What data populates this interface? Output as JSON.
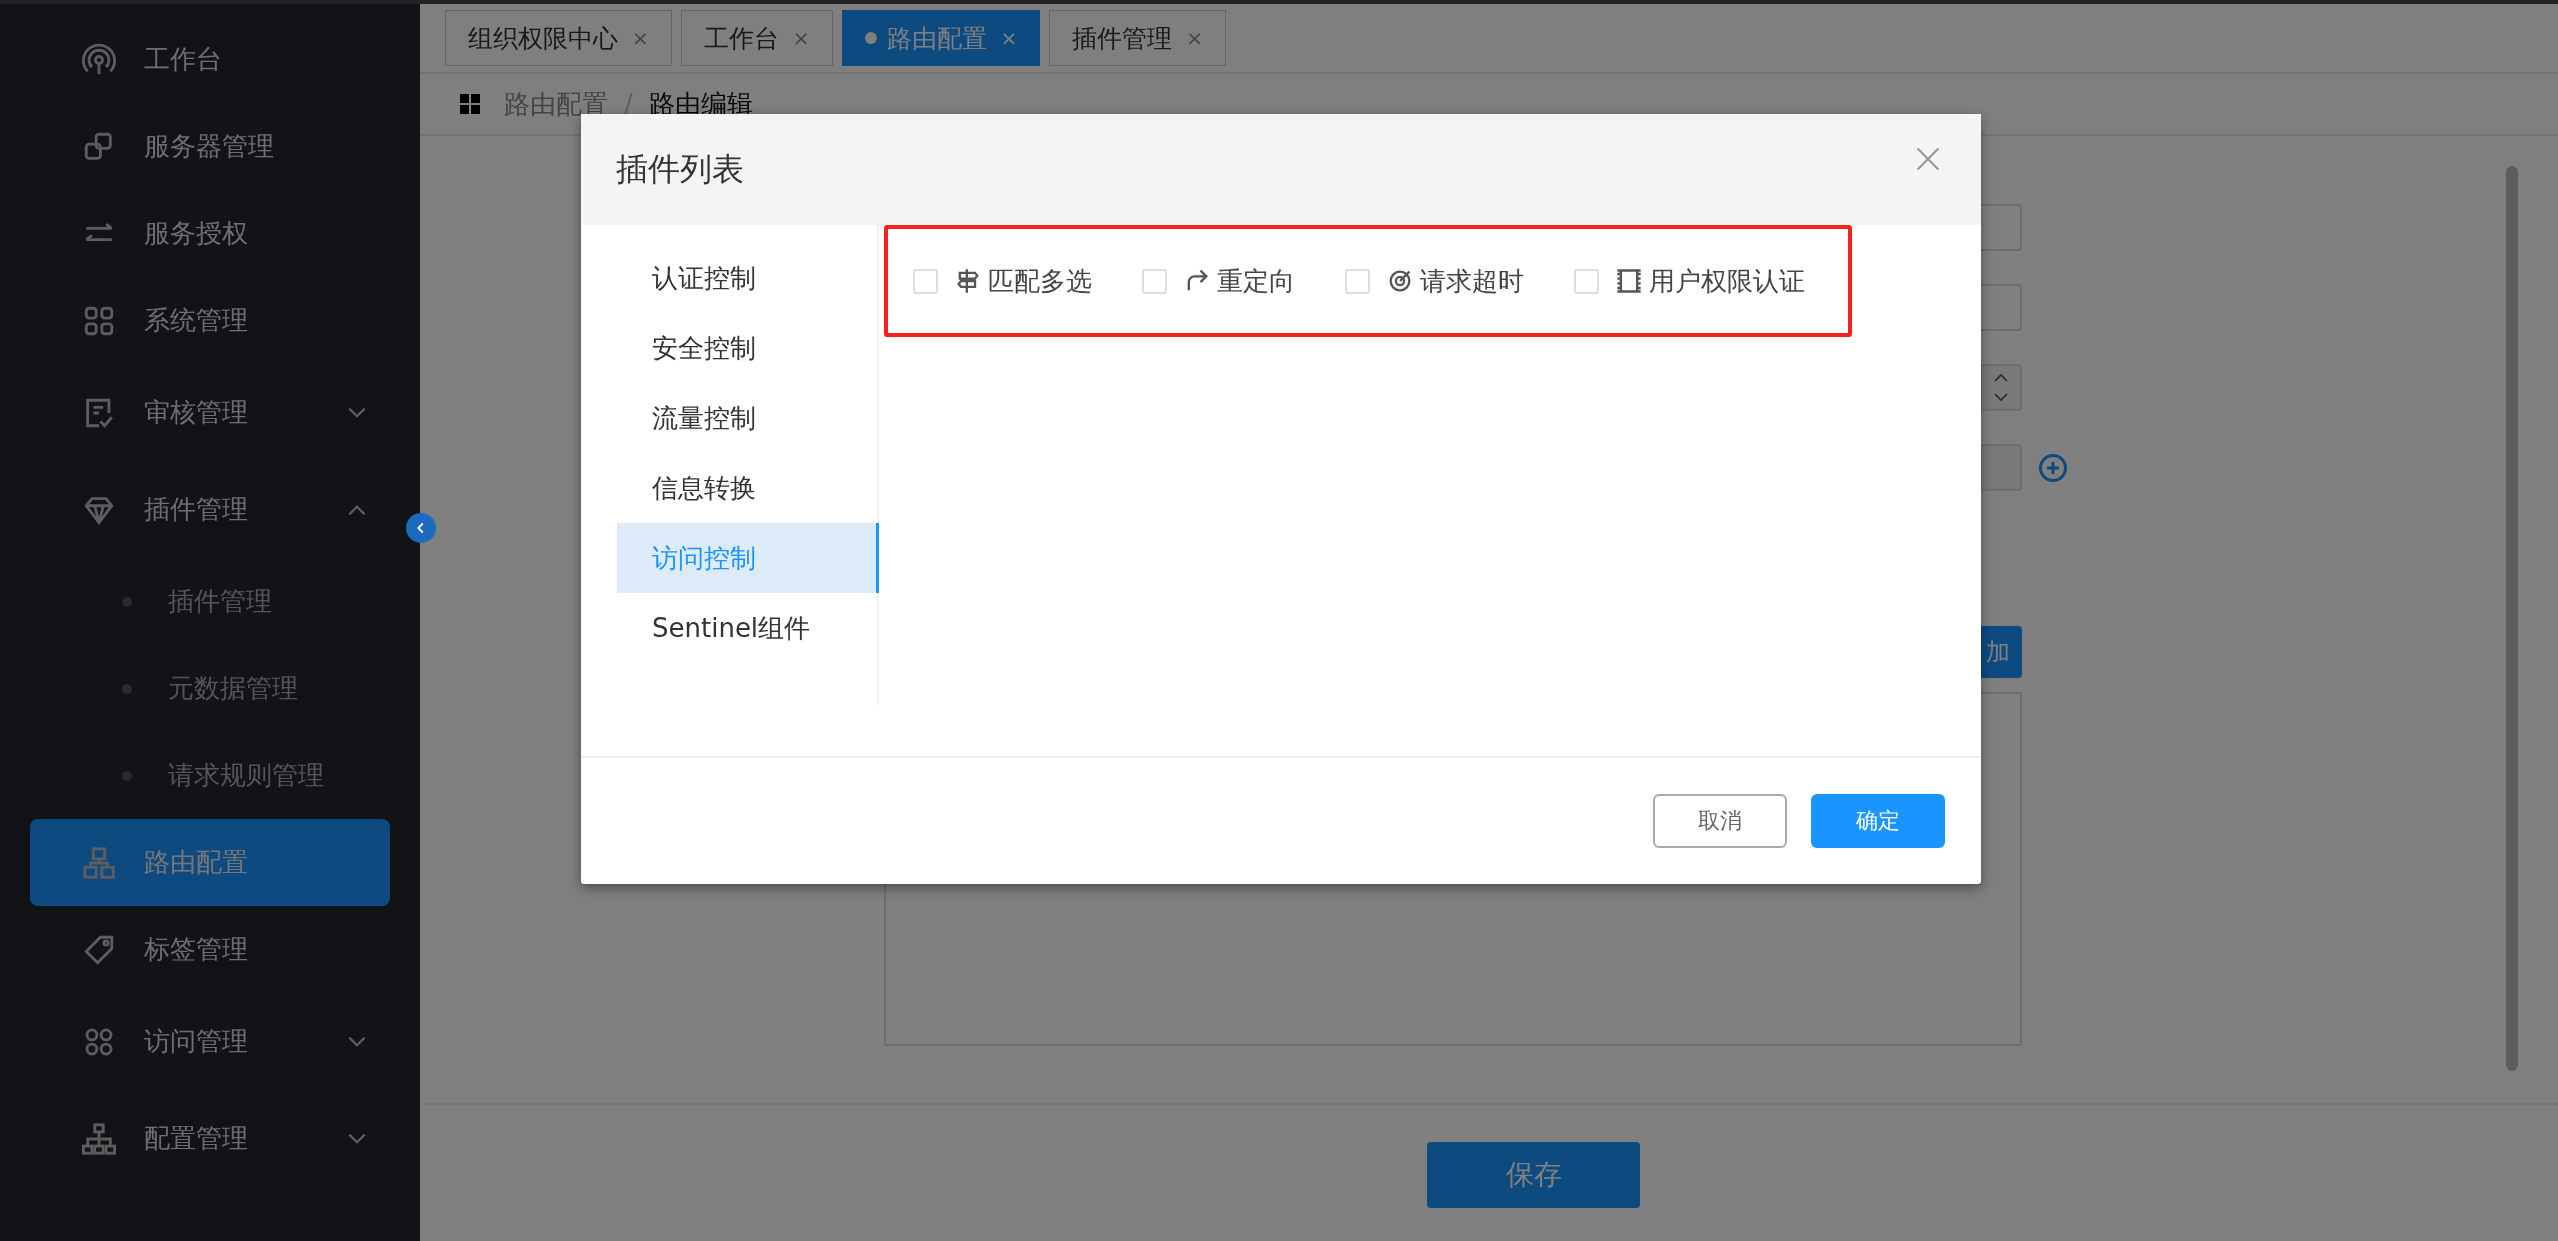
{
  "sidebar": {
    "items": [
      {
        "kind": "link",
        "label": "工作台",
        "selected": false
      },
      {
        "kind": "link",
        "label": "服务器管理",
        "selected": false
      },
      {
        "kind": "link",
        "label": "服务授权",
        "selected": false
      },
      {
        "kind": "link",
        "label": "系统管理",
        "selected": false
      },
      {
        "kind": "group",
        "label": "审核管理",
        "selected": false,
        "expanded": false
      },
      {
        "kind": "group",
        "label": "插件管理",
        "selected": false,
        "expanded": true,
        "children": [
          {
            "label": "插件管理",
            "selected": false
          },
          {
            "label": "元数据管理",
            "selected": false
          },
          {
            "label": "请求规则管理",
            "selected": false
          }
        ]
      },
      {
        "kind": "link",
        "label": "路由配置",
        "selected": true
      },
      {
        "kind": "link",
        "label": "标签管理",
        "selected": false
      },
      {
        "kind": "group",
        "label": "访问管理",
        "selected": false,
        "expanded": false
      },
      {
        "kind": "group",
        "label": "配置管理",
        "selected": false,
        "expanded": false
      }
    ]
  },
  "tabs": [
    {
      "label": "组织权限中心",
      "selected": false,
      "close": "×"
    },
    {
      "label": "工作台",
      "selected": false,
      "close": "×"
    },
    {
      "label": "路由配置",
      "selected": true,
      "close": "×"
    },
    {
      "label": "插件管理",
      "selected": false,
      "close": "×"
    }
  ],
  "breadcrumb": {
    "items": [
      "路由配置",
      "路由编辑"
    ],
    "separator": "/"
  },
  "form": {
    "add_button": "加",
    "save_button": "保存"
  },
  "modal": {
    "title": "插件列表",
    "categories": [
      {
        "label": "认证控制",
        "selected": false
      },
      {
        "label": "安全控制",
        "selected": false
      },
      {
        "label": "流量控制",
        "selected": false
      },
      {
        "label": "信息转换",
        "selected": false
      },
      {
        "label": "访问控制",
        "selected": true
      },
      {
        "label": "Sentinel组件",
        "selected": false
      }
    ],
    "plugins": [
      {
        "label": "匹配多选",
        "checked": false
      },
      {
        "label": "重定向",
        "checked": false
      },
      {
        "label": "请求超时",
        "checked": false
      },
      {
        "label": "用户权限认证",
        "checked": false
      }
    ],
    "cancel_button": "取消",
    "confirm_button": "确定"
  }
}
